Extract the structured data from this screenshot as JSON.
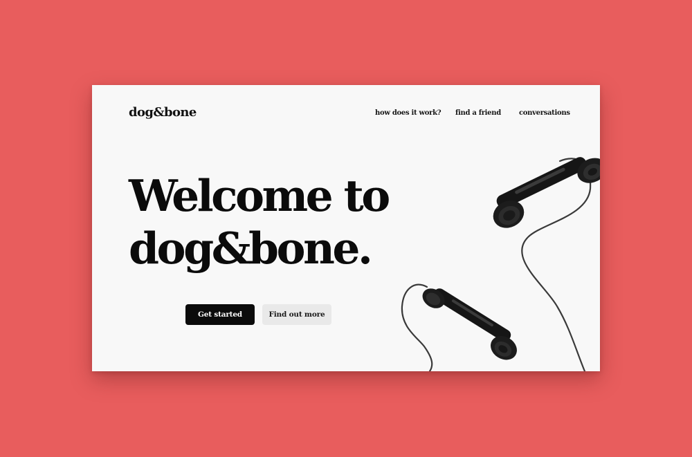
{
  "brand": {
    "logo": "dog&bone"
  },
  "nav": {
    "items": [
      {
        "label": "how does it work?"
      },
      {
        "label": "find a friend"
      },
      {
        "label": "conversations"
      }
    ]
  },
  "hero": {
    "line1": "Welcome to",
    "line2": "dog&bone."
  },
  "actions": {
    "primary_label": "Get started",
    "secondary_label": "Find out more"
  },
  "colors": {
    "background": "#e85d5d",
    "card": "#f8f8f8",
    "primary_button": "#0b0b0b",
    "secondary_button": "#e9e9e9",
    "text": "#0b0b0b"
  },
  "icons": {
    "hero_image": "telephone-handsets-icon"
  }
}
